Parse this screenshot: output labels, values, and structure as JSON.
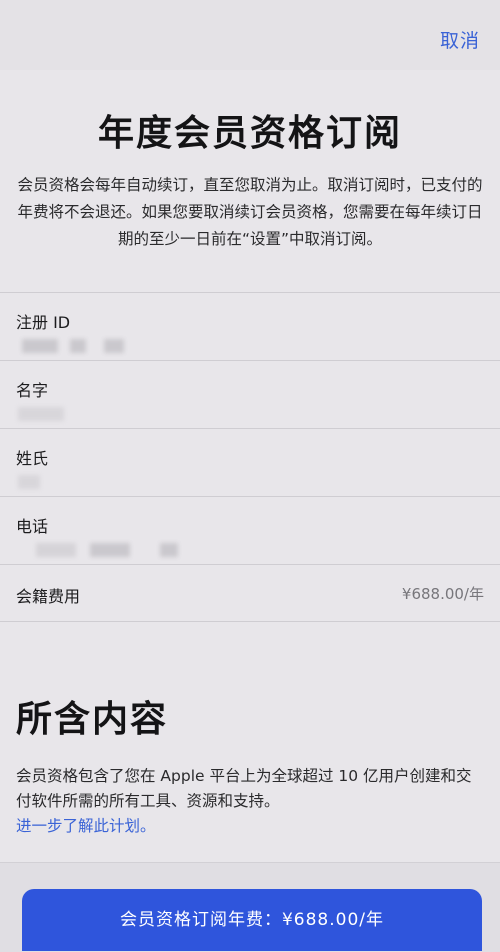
{
  "nav": {
    "cancel_label": "取消"
  },
  "header": {
    "title": "年度会员资格订阅",
    "description": "会员资格会每年自动续订，直至您取消为止。取消订阅时，已支付的年费将不会退还。如果您要取消续订会员资格，您需要在每年续订日期的至少一日前在“设置”中取消订阅。"
  },
  "form": {
    "fields": [
      {
        "label": "注册 ID"
      },
      {
        "label": "名字"
      },
      {
        "label": "姓氏"
      },
      {
        "label": "电话"
      }
    ],
    "fee": {
      "label": "会籍费用",
      "value": "¥688.00/年"
    }
  },
  "includes": {
    "title": "所含内容",
    "body": "会员资格包含了您在 Apple 平台上为全球超过 10 亿用户创建和交付软件所需的所有工具、资源和支持。",
    "link": "进一步了解此计划。"
  },
  "footer": {
    "subscribe_label": "会员资格订阅年费：¥688.00/年"
  },
  "colors": {
    "accent": "#3a63d6",
    "button": "#2f55dc",
    "background": "#e8e6ea"
  }
}
